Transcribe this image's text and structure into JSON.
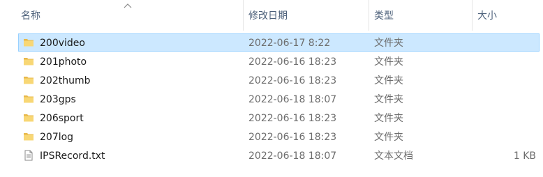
{
  "header": {
    "name": "名称",
    "date": "修改日期",
    "type": "类型",
    "size": "大小"
  },
  "files": [
    {
      "name": "200video",
      "date": "2022-06-17 8:22",
      "type": "文件夹",
      "size": "",
      "icon": "folder-icon",
      "selected": true
    },
    {
      "name": "201photo",
      "date": "2022-06-16 18:23",
      "type": "文件夹",
      "size": "",
      "icon": "folder-icon",
      "selected": false
    },
    {
      "name": "202thumb",
      "date": "2022-06-16 18:23",
      "type": "文件夹",
      "size": "",
      "icon": "folder-icon",
      "selected": false
    },
    {
      "name": "203gps",
      "date": "2022-06-18 18:07",
      "type": "文件夹",
      "size": "",
      "icon": "folder-icon",
      "selected": false
    },
    {
      "name": "206sport",
      "date": "2022-06-16 18:23",
      "type": "文件夹",
      "size": "",
      "icon": "folder-icon",
      "selected": false
    },
    {
      "name": "207log",
      "date": "2022-06-16 18:23",
      "type": "文件夹",
      "size": "",
      "icon": "folder-icon",
      "selected": false
    },
    {
      "name": "IPSRecord.txt",
      "date": "2022-06-18 18:07",
      "type": "文本文档",
      "size": "1 KB",
      "icon": "text-file-icon",
      "selected": false
    }
  ],
  "colors": {
    "selected_bg": "#cce8ff",
    "selected_border": "#99d1ff",
    "header_text": "#4c607a",
    "folder_yellow": "#f8d775",
    "folder_dark": "#e8b84a"
  }
}
